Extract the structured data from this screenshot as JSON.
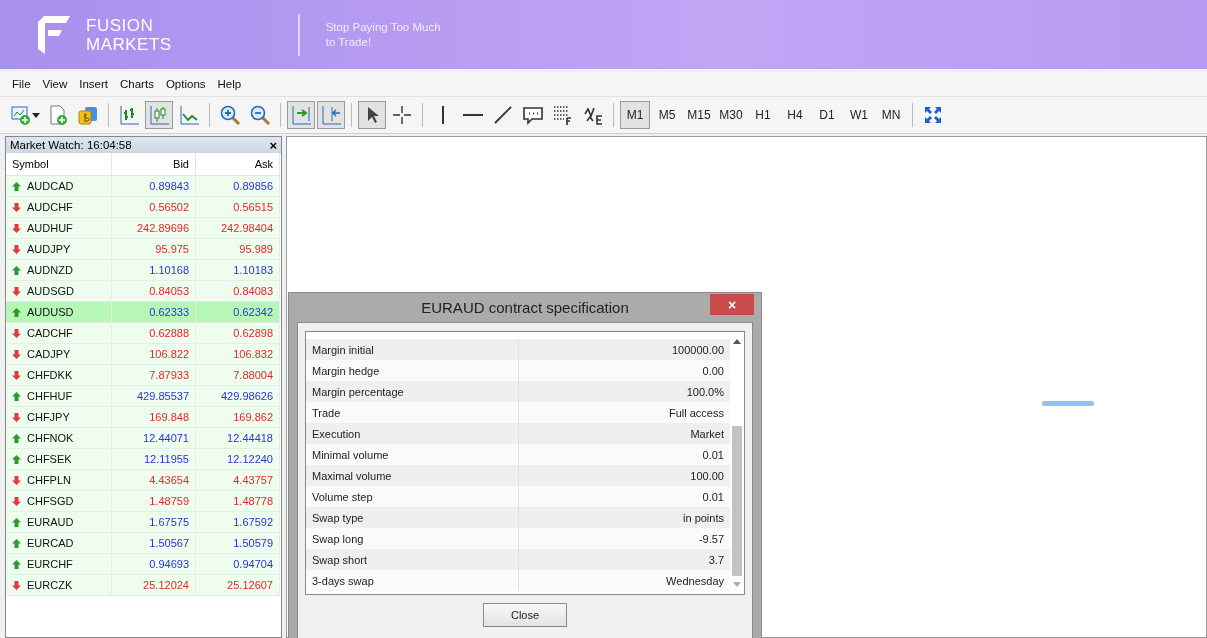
{
  "banner": {
    "brand_line1": "FUSION",
    "brand_line2": "MARKETS",
    "tagline_line1": "Stop Paying Too Much",
    "tagline_line2": "to Trade!"
  },
  "menu": [
    "File",
    "View",
    "Insert",
    "Charts",
    "Options",
    "Help"
  ],
  "toolbar": {
    "tools": [
      {
        "kind": "tool",
        "selected": false
      },
      {
        "kind": "tool",
        "selected": false
      },
      {
        "kind": "tool",
        "selected": false
      },
      {
        "kind": "separator"
      },
      {
        "kind": "tool",
        "selected": false
      },
      {
        "kind": "tool",
        "selected": true
      },
      {
        "kind": "tool",
        "selected": false
      },
      {
        "kind": "separator"
      },
      {
        "kind": "tool",
        "selected": false
      },
      {
        "kind": "tool",
        "selected": false
      },
      {
        "kind": "separator"
      },
      {
        "kind": "tool",
        "selected": true
      },
      {
        "kind": "tool",
        "selected": true
      },
      {
        "kind": "separator"
      },
      {
        "kind": "tool",
        "selected": true
      },
      {
        "kind": "tool",
        "selected": false
      },
      {
        "kind": "separator"
      },
      {
        "kind": "tool",
        "selected": false
      },
      {
        "kind": "tool",
        "selected": false
      },
      {
        "kind": "tool",
        "selected": false
      },
      {
        "kind": "tool",
        "selected": false
      },
      {
        "kind": "tool",
        "selected": false
      },
      {
        "kind": "tool",
        "selected": false
      },
      {
        "kind": "separator"
      }
    ],
    "timeframes": [
      {
        "label": "M1",
        "selected": true
      },
      {
        "label": "M5",
        "selected": false
      },
      {
        "label": "M15",
        "selected": false
      },
      {
        "label": "M30",
        "selected": false
      },
      {
        "label": "H1",
        "selected": false
      },
      {
        "label": "H4",
        "selected": false
      },
      {
        "label": "D1",
        "selected": false
      },
      {
        "label": "W1",
        "selected": false
      },
      {
        "label": "MN",
        "selected": false
      }
    ]
  },
  "market_watch": {
    "title": "Market Watch: 16:04:58",
    "close": "×",
    "columns": [
      "Symbol",
      "Bid",
      "Ask"
    ],
    "rows": [
      {
        "symbol": "AUDCAD",
        "bid": "0.89843",
        "ask": "0.89856",
        "rising": true,
        "selected": false
      },
      {
        "symbol": "AUDCHF",
        "bid": "0.56502",
        "ask": "0.56515",
        "rising": false,
        "selected": false
      },
      {
        "symbol": "AUDHUF",
        "bid": "242.89696",
        "ask": "242.98404",
        "rising": false,
        "selected": false
      },
      {
        "symbol": "AUDJPY",
        "bid": "95.975",
        "ask": "95.989",
        "rising": false,
        "selected": false
      },
      {
        "symbol": "AUDNZD",
        "bid": "1.10168",
        "ask": "1.10183",
        "rising": true,
        "selected": false
      },
      {
        "symbol": "AUDSGD",
        "bid": "0.84053",
        "ask": "0.84083",
        "rising": false,
        "selected": false
      },
      {
        "symbol": "AUDUSD",
        "bid": "0.62333",
        "ask": "0.62342",
        "rising": true,
        "selected": true
      },
      {
        "symbol": "CADCHF",
        "bid": "0.62888",
        "ask": "0.62898",
        "rising": false,
        "selected": false
      },
      {
        "symbol": "CADJPY",
        "bid": "106.822",
        "ask": "106.832",
        "rising": false,
        "selected": false
      },
      {
        "symbol": "CHFDKK",
        "bid": "7.87933",
        "ask": "7.88004",
        "rising": false,
        "selected": false
      },
      {
        "symbol": "CHFHUF",
        "bid": "429.85537",
        "ask": "429.98626",
        "rising": true,
        "selected": false
      },
      {
        "symbol": "CHFJPY",
        "bid": "169.848",
        "ask": "169.862",
        "rising": false,
        "selected": false
      },
      {
        "symbol": "CHFNOK",
        "bid": "12.44071",
        "ask": "12.44418",
        "rising": true,
        "selected": false
      },
      {
        "symbol": "CHFSEK",
        "bid": "12.11955",
        "ask": "12.12240",
        "rising": true,
        "selected": false
      },
      {
        "symbol": "CHFPLN",
        "bid": "4.43654",
        "ask": "4.43757",
        "rising": false,
        "selected": false
      },
      {
        "symbol": "CHFSGD",
        "bid": "1.48759",
        "ask": "1.48778",
        "rising": false,
        "selected": false
      },
      {
        "symbol": "EURAUD",
        "bid": "1.67575",
        "ask": "1.67592",
        "rising": true,
        "selected": false
      },
      {
        "symbol": "EURCAD",
        "bid": "1.50567",
        "ask": "1.50579",
        "rising": true,
        "selected": false
      },
      {
        "symbol": "EURCHF",
        "bid": "0.94693",
        "ask": "0.94704",
        "rising": true,
        "selected": false
      },
      {
        "symbol": "EURCZK",
        "bid": "25.12024",
        "ask": "25.12607",
        "rising": false,
        "selected": false
      }
    ]
  },
  "dialog": {
    "title": "EURAUD contract specification",
    "close": "×",
    "button": "Close",
    "rows": [
      {
        "name": "Margin initial",
        "value": "100000.00"
      },
      {
        "name": "Margin hedge",
        "value": "0.00"
      },
      {
        "name": "Margin percentage",
        "value": "100.0%"
      },
      {
        "name": "Trade",
        "value": "Full access"
      },
      {
        "name": "Execution",
        "value": "Market"
      },
      {
        "name": "Minimal volume",
        "value": "0.01"
      },
      {
        "name": "Maximal volume",
        "value": "100.00"
      },
      {
        "name": "Volume step",
        "value": "0.01"
      },
      {
        "name": "Swap type",
        "value": "in points"
      },
      {
        "name": "Swap long",
        "value": "-9.57"
      },
      {
        "name": "Swap short",
        "value": "3.7"
      },
      {
        "name": "3-days swap",
        "value": "Wednesday"
      }
    ]
  }
}
